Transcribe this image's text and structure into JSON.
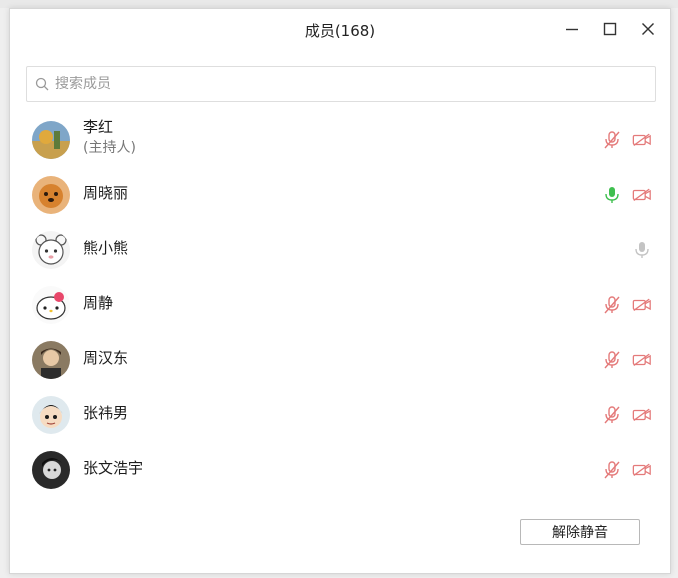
{
  "window": {
    "title": "成员(168)"
  },
  "search": {
    "placeholder": "搜索成员"
  },
  "members": [
    {
      "name": "李红",
      "role": "(主持人)",
      "mic": "muted",
      "camera": "off"
    },
    {
      "name": "周晓丽",
      "role": "",
      "mic": "active",
      "camera": "off"
    },
    {
      "name": "熊小熊",
      "role": "",
      "mic": "idle",
      "camera": "none"
    },
    {
      "name": "周静",
      "role": "",
      "mic": "muted",
      "camera": "off"
    },
    {
      "name": "周汉东",
      "role": "",
      "mic": "muted",
      "camera": "off"
    },
    {
      "name": "张祎男",
      "role": "",
      "mic": "muted",
      "camera": "off"
    },
    {
      "name": "张文浩宇",
      "role": "",
      "mic": "muted",
      "camera": "off"
    }
  ],
  "footer": {
    "unmute_label": "解除静音"
  },
  "colors": {
    "muted": "#e47a7a",
    "active": "#3fbf4f",
    "idle": "#b8b8b8",
    "camera_off": "#e47a7a"
  }
}
